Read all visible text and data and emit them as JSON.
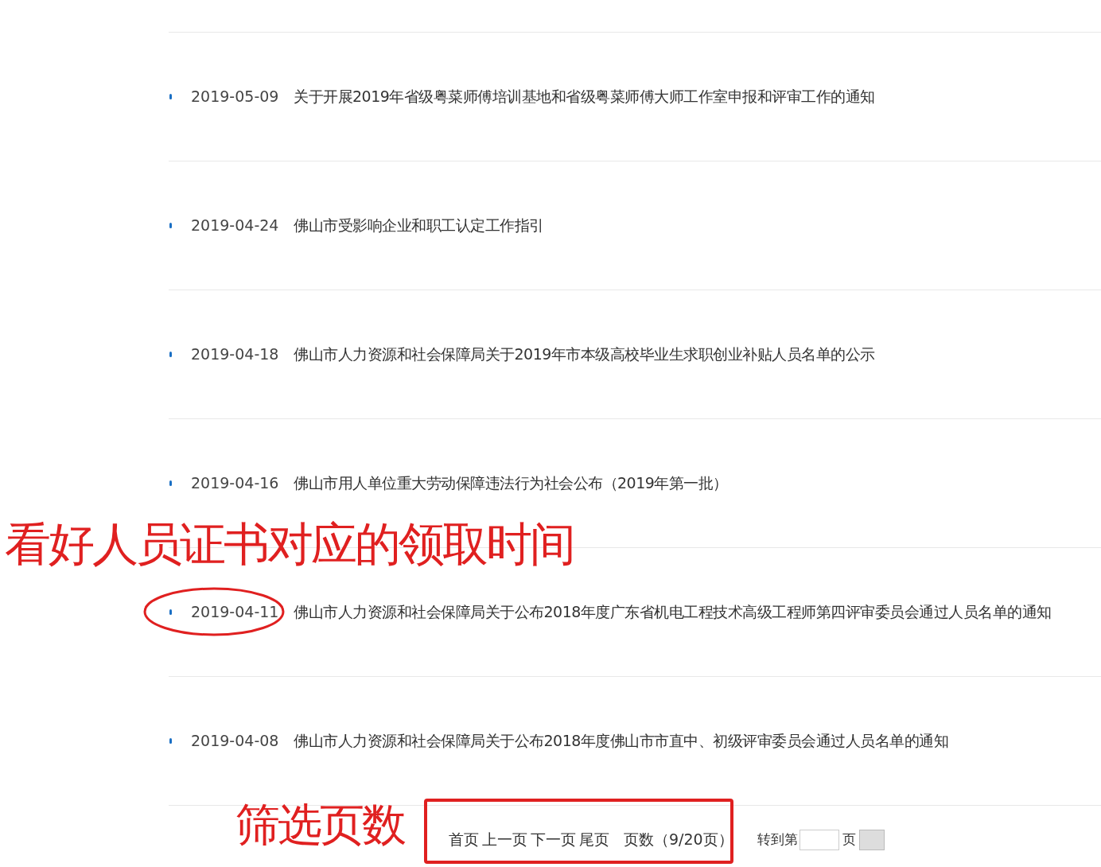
{
  "news_list": [
    {
      "date": "2019-05-09",
      "title": "关于开展2019年省级粤菜师傅培训基地和省级粤菜师傅大师工作室申报和评审工作的通知",
      "circled": false
    },
    {
      "date": "2019-04-24",
      "title": "佛山市受影响企业和职工认定工作指引",
      "circled": false
    },
    {
      "date": "2019-04-18",
      "title": "佛山市人力资源和社会保障局关于2019年市本级高校毕业生求职创业补贴人员名单的公示",
      "circled": false
    },
    {
      "date": "2019-04-16",
      "title": "佛山市用人单位重大劳动保障违法行为社会公布（2019年第一批）",
      "circled": false
    },
    {
      "date": "2019-04-11",
      "title": "佛山市人力资源和社会保障局关于公布2018年度广东省机电工程技术高级工程师第四评审委员会通过人员名单的通知",
      "circled": true
    },
    {
      "date": "2019-04-08",
      "title": "佛山市人力资源和社会保障局关于公布2018年度佛山市市直中、初级评审委员会通过人员名单的通知",
      "circled": false
    }
  ],
  "pagination": {
    "links": [
      "首页",
      "上一页",
      "下一页",
      "尾页"
    ],
    "page_count": "页数（9/20页）",
    "goto_label": "转到第",
    "goto_suffix": "页",
    "framed": true
  },
  "callouts": [
    {
      "text": "看好人员证书对应的领取时间"
    },
    {
      "text": "筛选页数"
    }
  ]
}
